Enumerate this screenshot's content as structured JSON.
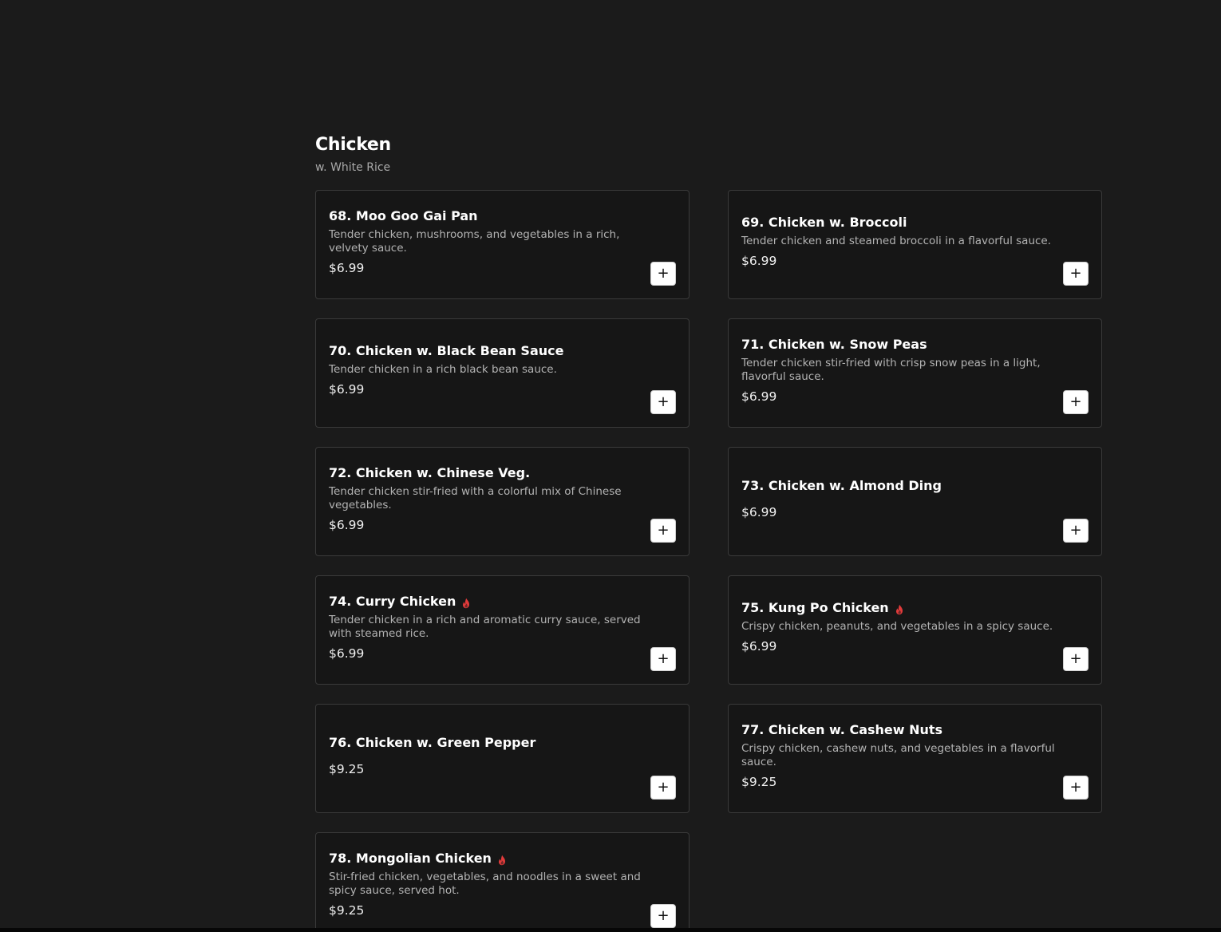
{
  "colors": {
    "background": "#1b1b1b",
    "card_background": "#161616",
    "card_border": "#3a3a3a",
    "spicy": "#e23b3b",
    "button_background": "#ffffff"
  },
  "section": {
    "title": "Chicken",
    "subtitle": "w. White Rice"
  },
  "add_button_label": "+",
  "items": [
    {
      "name": "68. Moo Goo Gai Pan",
      "description": "Tender chicken, mushrooms, and vegetables in a rich, velvety sauce.",
      "price": "$6.99",
      "spicy": false
    },
    {
      "name": "69. Chicken w. Broccoli",
      "description": "Tender chicken and steamed broccoli in a flavorful sauce.",
      "price": "$6.99",
      "spicy": false
    },
    {
      "name": "70. Chicken w. Black Bean Sauce",
      "description": "Tender chicken in a rich black bean sauce.",
      "price": "$6.99",
      "spicy": false
    },
    {
      "name": "71. Chicken w. Snow Peas",
      "description": "Tender chicken stir-fried with crisp snow peas in a light, flavorful sauce.",
      "price": "$6.99",
      "spicy": false
    },
    {
      "name": "72. Chicken w. Chinese Veg.",
      "description": "Tender chicken stir-fried with a colorful mix of Chinese vegetables.",
      "price": "$6.99",
      "spicy": false
    },
    {
      "name": "73. Chicken w. Almond Ding",
      "description": "",
      "price": "$6.99",
      "spicy": false
    },
    {
      "name": "74. Curry Chicken",
      "description": "Tender chicken in a rich and aromatic curry sauce, served with steamed rice.",
      "price": "$6.99",
      "spicy": true
    },
    {
      "name": "75. Kung Po Chicken",
      "description": "Crispy chicken, peanuts, and vegetables in a spicy sauce.",
      "price": "$6.99",
      "spicy": true
    },
    {
      "name": "76. Chicken w. Green Pepper",
      "description": "",
      "price": "$9.25",
      "spicy": false
    },
    {
      "name": "77. Chicken w. Cashew Nuts",
      "description": "Crispy chicken, cashew nuts, and vegetables in a flavorful sauce.",
      "price": "$9.25",
      "spicy": false
    },
    {
      "name": "78. Mongolian Chicken",
      "description": "Stir-fried chicken, vegetables, and noodles in a sweet and spicy sauce, served hot.",
      "price": "$9.25",
      "spicy": true
    }
  ]
}
